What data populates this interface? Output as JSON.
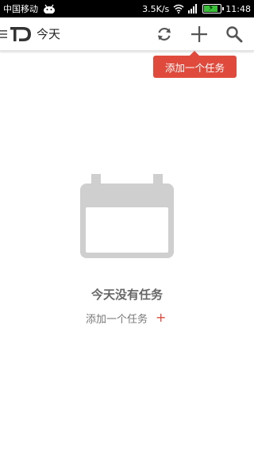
{
  "status_bar": {
    "carrier": "中国移动",
    "speed": "3.5K/s",
    "time": "11:48",
    "battery_level": 0.85
  },
  "toolbar": {
    "title": "今天",
    "actions": [
      "refresh-icon",
      "add-icon",
      "search-icon"
    ]
  },
  "tooltip": {
    "text": "添加一个任务"
  },
  "empty_state": {
    "title": "今天没有任务",
    "add_label": "添加一个任务",
    "add_symbol": "+"
  },
  "colors": {
    "accent": "#e04a3c",
    "icon_gray": "#555555",
    "illustration": "#cfcfcf"
  }
}
